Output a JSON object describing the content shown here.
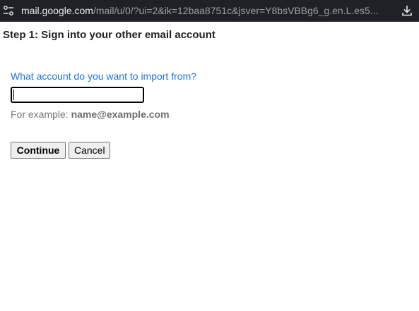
{
  "browser": {
    "url_host": "mail.google.com",
    "url_path": "/mail/u/0/?ui=2&ik=12baa8751c&jsver=Y8bsVBBg6_g.en.L.es5..."
  },
  "page": {
    "title": "Step 1: Sign into your other email account",
    "question": "What account do you want to import from?",
    "email_value": "",
    "example_prefix": "For example: ",
    "example_value": "name@example.com",
    "continue_label": "Continue",
    "cancel_label": "Cancel"
  },
  "icons": {
    "site_info": "tune-icon",
    "download": "download-icon"
  },
  "colors": {
    "question_link": "#1a73e8",
    "urlbar_bg": "#202124"
  }
}
